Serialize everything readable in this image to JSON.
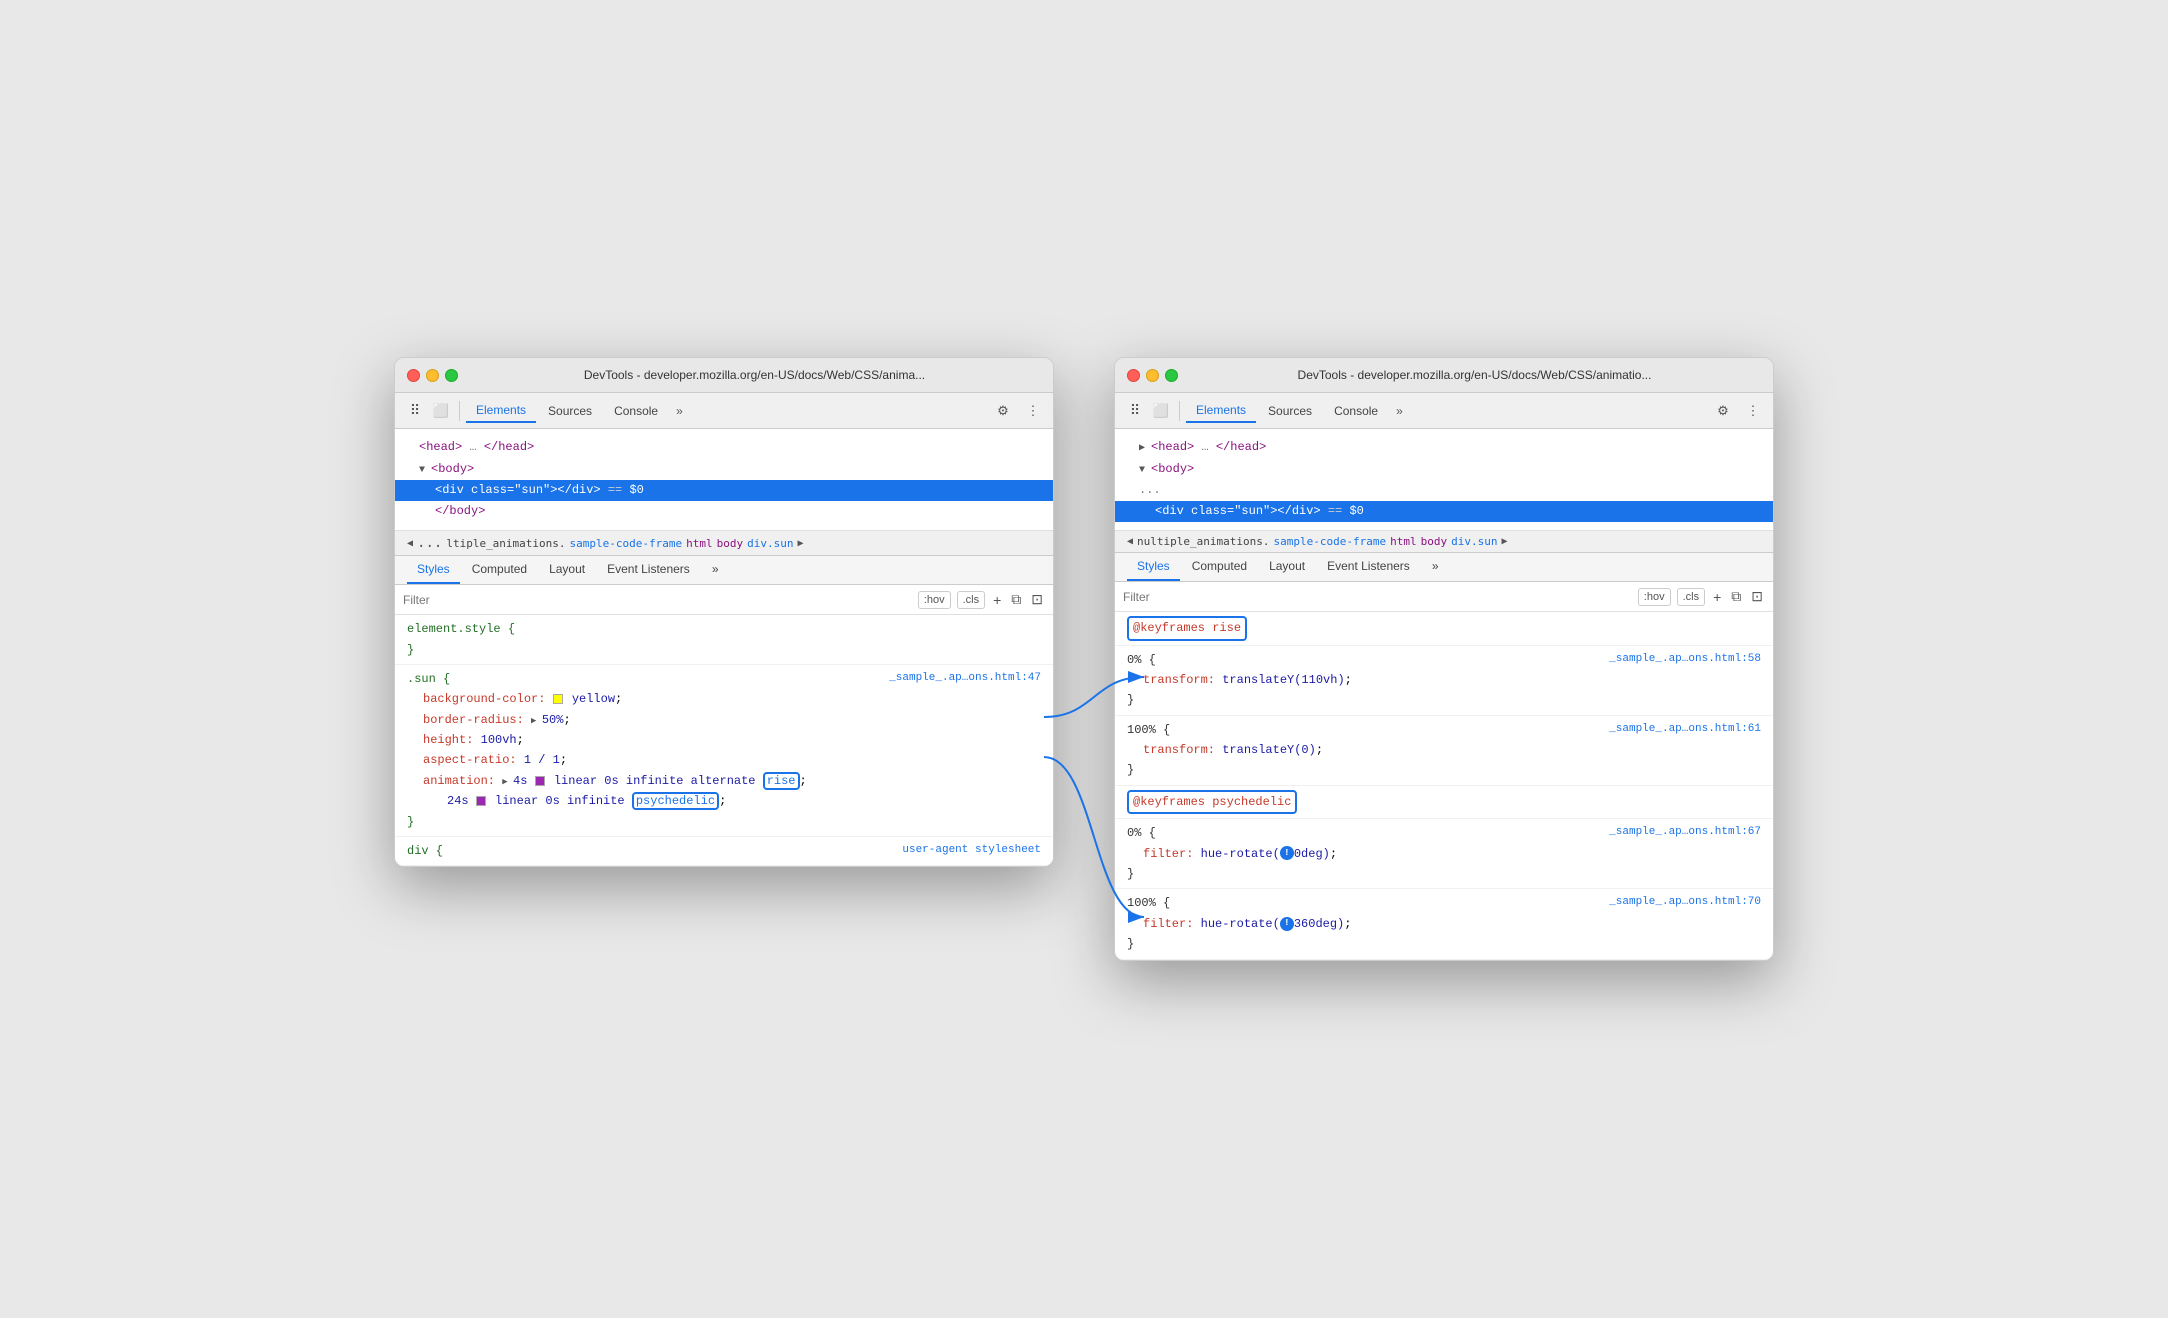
{
  "window1": {
    "title": "DevTools - developer.mozilla.org/en-US/docs/Web/CSS/anima...",
    "traffic_lights": [
      "red",
      "yellow",
      "green"
    ],
    "toolbar": {
      "tabs": [
        "Elements",
        "Sources",
        "Console"
      ],
      "active_tab": "Elements",
      "more_label": "»",
      "settings_icon": "⚙",
      "more_icon": "⋮"
    },
    "html_tree": {
      "lines": [
        {
          "indent": 2,
          "content": "▶ <head> … </head>",
          "selected": false
        },
        {
          "indent": 2,
          "content": "▼ <body>",
          "selected": false
        },
        {
          "indent": 3,
          "content": "<div class=\"sun\"></div>  == $0",
          "selected": true
        },
        {
          "indent": 3,
          "content": "</body>",
          "selected": false
        }
      ]
    },
    "breadcrumb": {
      "dots": "...",
      "items": [
        "ltiple_animations.",
        "sample-code-frame",
        "html",
        "body",
        "div.sun"
      ],
      "arrow_right": "▶"
    },
    "tabs": [
      "Styles",
      "Computed",
      "Layout",
      "Event Listeners",
      "»"
    ],
    "active_panel_tab": "Styles",
    "filter_placeholder": "Filter",
    "filter_hov": ":hov",
    "filter_cls": ".cls",
    "filter_plus": "+",
    "css_rules": [
      {
        "selector": "element.style {",
        "closing": "}",
        "properties": []
      },
      {
        "selector": ".sun {",
        "source": "_sample_.ap…ons.html:47",
        "closing": "}",
        "properties": [
          {
            "name": "background-color:",
            "value": "yellow;",
            "has_swatch": true,
            "swatch_color": "yellow"
          },
          {
            "name": "border-radius:",
            "value": "▶ 50%;",
            "has_swatch": false
          },
          {
            "name": "height:",
            "value": "100vh;",
            "has_swatch": false
          },
          {
            "name": "aspect-ratio:",
            "value": "1 / 1;",
            "has_swatch": false
          },
          {
            "name": "animation:",
            "value": "▶ 4s  linear 0s infinite alternate rise",
            "value2": "24s  linear 0s infinite  psychedelic;",
            "has_anim": true
          }
        ]
      }
    ],
    "bottom_label": "div {",
    "bottom_comment": "user-agent stylesheet"
  },
  "window2": {
    "title": "DevTools - developer.mozilla.org/en-US/docs/Web/CSS/animatio...",
    "traffic_lights": [
      "red",
      "yellow",
      "green"
    ],
    "toolbar": {
      "tabs": [
        "Elements",
        "Sources",
        "Console"
      ],
      "active_tab": "Elements",
      "more_label": "»",
      "settings_icon": "⚙",
      "more_icon": "⋮"
    },
    "html_tree": {
      "lines": [
        {
          "indent": 2,
          "content": "▶ <head> … </head>",
          "selected": false
        },
        {
          "indent": 2,
          "content": "▼ <body>",
          "selected": false
        },
        {
          "indent": 2,
          "content": "...",
          "selected": false
        },
        {
          "indent": 3,
          "content": "<div class=\"sun\"></div>  == $0",
          "selected": true
        }
      ]
    },
    "breadcrumb": {
      "dots": "",
      "arrow": "◀",
      "items": [
        "nultiple_animations.",
        "sample-code-frame",
        "html",
        "body",
        "div.sun"
      ],
      "arrow_right": "▶"
    },
    "tabs": [
      "Styles",
      "Computed",
      "Layout",
      "Event Listeners",
      "»"
    ],
    "active_panel_tab": "Styles",
    "filter_placeholder": "Filter",
    "filter_hov": ":hov",
    "filter_cls": ".cls",
    "keyframes_rules": [
      {
        "name": "@keyframes rise",
        "highlighted": true,
        "rules": [
          {
            "percent": "0% {",
            "source": "_sample_.ap…ons.html:58",
            "properties": [
              {
                "name": "transform:",
                "value": "translateY(110vh);"
              }
            ],
            "closing": "}"
          },
          {
            "percent": "100% {",
            "source": "_sample_.ap…ons.html:61",
            "properties": [
              {
                "name": "transform:",
                "value": "translateY(0);"
              }
            ],
            "closing": "}"
          }
        ]
      },
      {
        "name": "@keyframes psychedelic",
        "highlighted": true,
        "rules": [
          {
            "percent": "0% {",
            "source": "_sample_.ap…ons.html:67",
            "properties": [
              {
                "name": "filter:",
                "value": "hue-rotate(⚠0deg);"
              }
            ],
            "closing": "}"
          },
          {
            "percent": "100% {",
            "source": "_sample_.ap…ons.html:70",
            "properties": [
              {
                "name": "filter:",
                "value": "hue-rotate(⚠360deg);"
              }
            ],
            "closing": "}"
          }
        ]
      }
    ]
  },
  "arrows": [
    {
      "from": "rise",
      "to": "keyframes_rise"
    },
    {
      "from": "psychedelic",
      "to": "keyframes_psychedelic"
    }
  ]
}
